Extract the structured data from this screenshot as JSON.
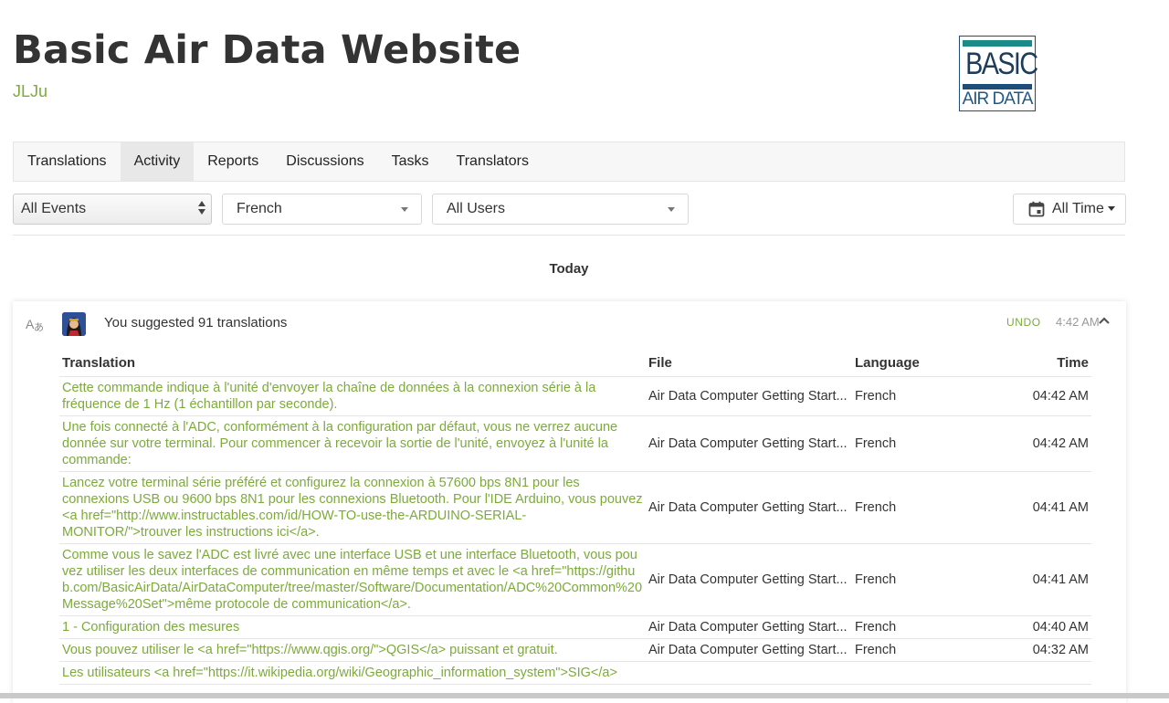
{
  "project": {
    "title": "Basic Air Data Website",
    "owner": "JLJu",
    "logo": {
      "line1": "BASIC",
      "line2": "AIR DATA"
    }
  },
  "tabs": [
    {
      "label": "Translations",
      "active": false
    },
    {
      "label": "Activity",
      "active": true
    },
    {
      "label": "Reports",
      "active": false
    },
    {
      "label": "Discussions",
      "active": false
    },
    {
      "label": "Tasks",
      "active": false
    },
    {
      "label": "Translators",
      "active": false
    }
  ],
  "filters": {
    "events": "All Events",
    "language": "French",
    "users": "All Users",
    "time": "All Time"
  },
  "day_label": "Today",
  "activity": {
    "summary": "You suggested 91 translations",
    "undo_label": "UNDO",
    "timestamp": "4:42 AM",
    "columns": [
      "Translation",
      "File",
      "Language",
      "Time"
    ],
    "rows": [
      {
        "text": "Cette commande indique à l'unité d'envoyer la chaîne de données à la connexion série à la fréquence de 1 Hz (1 échantillon par seconde).",
        "file": "Air Data Computer Getting Start...",
        "language": "French",
        "time": "04:42 AM"
      },
      {
        "text": "Une fois connecté à l'ADC, conformément à la configuration par défaut, vous ne verrez aucune donnée sur votre terminal. Pour commencer à recevoir la sortie de l'unité, envoyez à l'unité la commande:",
        "file": "Air Data Computer Getting Start...",
        "language": "French",
        "time": "04:42 AM"
      },
      {
        "text": "Lancez votre terminal série préféré et configurez la connexion à 57600 bps 8N1 pour les connexions USB ou 9600 bps 8N1 pour les connexions Bluetooth. Pour l'IDE Arduino, vous pouvez <a href=\"http://www.instructables.com/id/HOW-TO-use-the-ARDUINO-SERIAL-MONITOR/\">trouver les instructions ici</a>.",
        "file": "Air Data Computer Getting Start...",
        "language": "French",
        "time": "04:41 AM"
      },
      {
        "text": "Comme vous le savez l'ADC est livré avec une interface USB et une interface Bluetooth, vous pouvez utiliser les deux interfaces de communication en même temps et avec le <a href=\"https://github.com/BasicAirData/AirDataComputer/tree/master/Software/Documentation/ADC%20Common%20Message%20Set\">même protocole de communication</a>.",
        "file": "Air Data Computer Getting Start...",
        "language": "French",
        "time": "04:41 AM"
      },
      {
        "text": "1 - Configuration des mesures",
        "file": "Air Data Computer Getting Start...",
        "language": "French",
        "time": "04:40 AM"
      },
      {
        "text": "Vous pouvez utiliser le <a href=\"https://www.qgis.org/\">QGIS</a> puissant et gratuit.",
        "file": "Air Data Computer Getting Start...",
        "language": "French",
        "time": "04:32 AM"
      },
      {
        "text": "Les utilisateurs <a href=\"https://it.wikipedia.org/wiki/Geographic_information_system\">SIG</a>",
        "file": "",
        "language": "",
        "time": ""
      }
    ]
  }
}
